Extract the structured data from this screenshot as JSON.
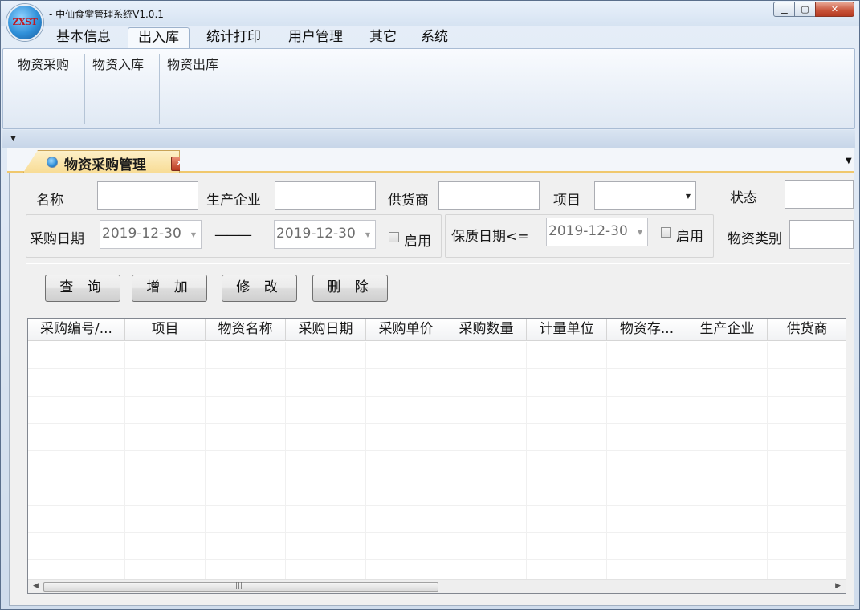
{
  "window": {
    "title": "- 中仙食堂管理系统V1.0.1",
    "logo_text": "ZXST",
    "minimize_glyph": "▁",
    "maximize_glyph": "▢",
    "close_glyph": "✕"
  },
  "menu": {
    "tabs": [
      {
        "label": "基本信息"
      },
      {
        "label": "出入库"
      },
      {
        "label": "统计打印"
      },
      {
        "label": "用户管理"
      },
      {
        "label": "其它"
      },
      {
        "label": "系统"
      }
    ],
    "active_tab": "出入库",
    "ribbon_items": [
      {
        "label": "物资采购"
      },
      {
        "label": "物资入库"
      },
      {
        "label": "物资出库"
      }
    ]
  },
  "document_tab": {
    "label": "物资采购管理",
    "close_glyph": "x"
  },
  "filters": {
    "name_label": "名称",
    "name_value": "",
    "manufacturer_label": "生产企业",
    "manufacturer_value": "",
    "supplier_label": "供货商",
    "supplier_value": "",
    "project_label": "项目",
    "project_value": "",
    "status_label": "状态",
    "status_value": "",
    "purchase_date_label": "采购日期",
    "purchase_date_from": "2019-12-30",
    "range_separator": "———",
    "purchase_date_to": "2019-12-30",
    "purchase_date_enable_label": "启用",
    "purchase_date_enabled": false,
    "shelf_date_label": "保质日期<=",
    "shelf_date_value": "2019-12-30",
    "shelf_date_enable_label": "启用",
    "shelf_date_enabled": false,
    "category_label": "物资类别",
    "category_value": ""
  },
  "actions": {
    "query": "查 询",
    "add": "增 加",
    "edit": "修 改",
    "delete": "删 除"
  },
  "grid": {
    "columns": [
      "采购编号/...",
      "项目",
      "物资名称",
      "采购日期",
      "采购单价",
      "采购数量",
      "计量单位",
      "物资存...",
      "生产企业",
      "供货商"
    ],
    "rows": [],
    "scroll_grip": "|||"
  }
}
